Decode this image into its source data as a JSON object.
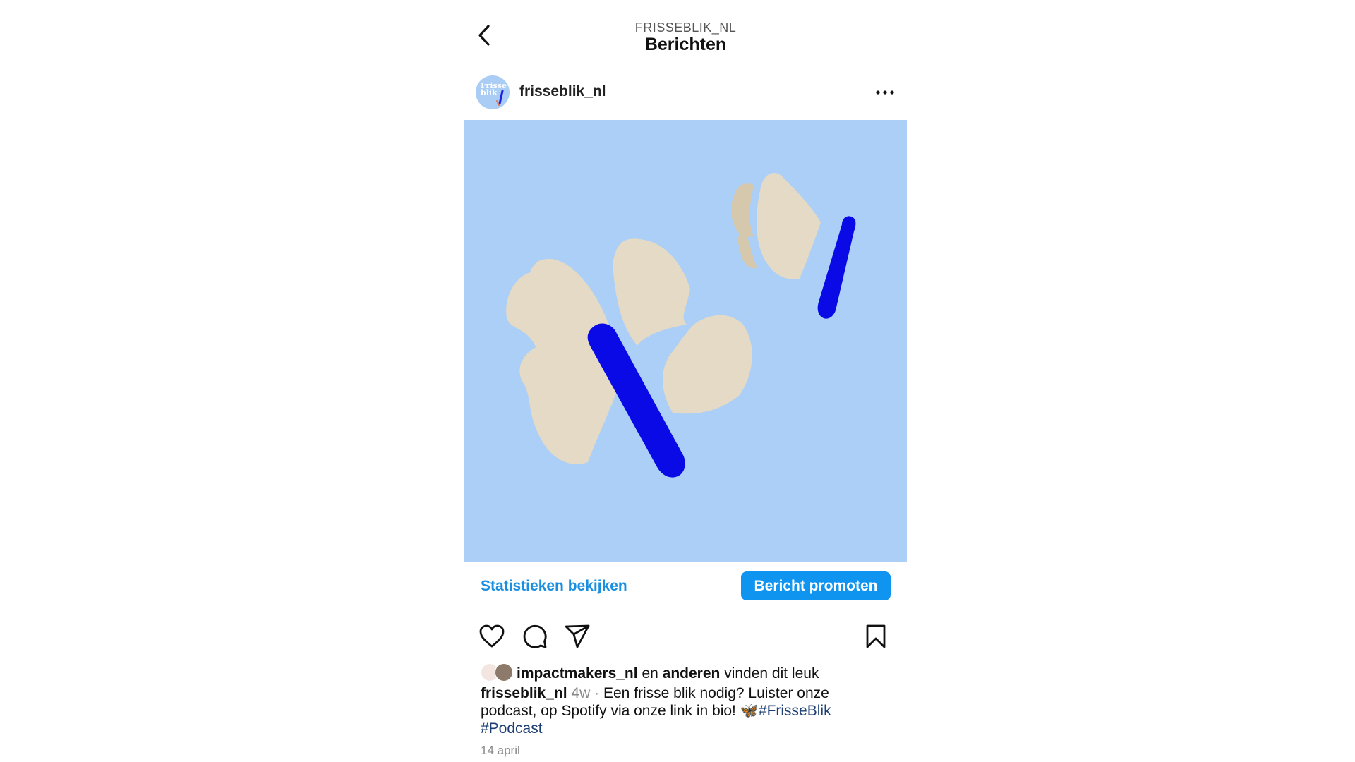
{
  "header": {
    "account_label": "FRISSEBLIK_NL",
    "title": "Berichten"
  },
  "post": {
    "username": "frisseblik_nl",
    "avatar_text": "Frisse blik",
    "image_background": "#abcff6",
    "butterfly_wing_color": "#e4dac6",
    "butterfly_body_color": "#0a0ae6"
  },
  "insights": {
    "stats_label": "Statistieken bekijken",
    "promote_label": "Bericht promoten",
    "accent_color": "#0f95f0"
  },
  "actions": {
    "icons": [
      "heart-icon",
      "comment-icon",
      "share-icon",
      "bookmark-icon"
    ]
  },
  "likes": {
    "user": "impactmakers_nl",
    "connector": "en",
    "others": "anderen",
    "suffix": "vinden dit leuk"
  },
  "caption": {
    "username": "frisseblik_nl",
    "time": "4w",
    "separator": "·",
    "text": "Een frisse blik nodig? Luister onze podcast, op Spotify via onze link in bio!",
    "emoji": "🦋",
    "hashtag1": "#FrisseBlik",
    "hashtag2": "#Podcast"
  },
  "date": "14 april"
}
